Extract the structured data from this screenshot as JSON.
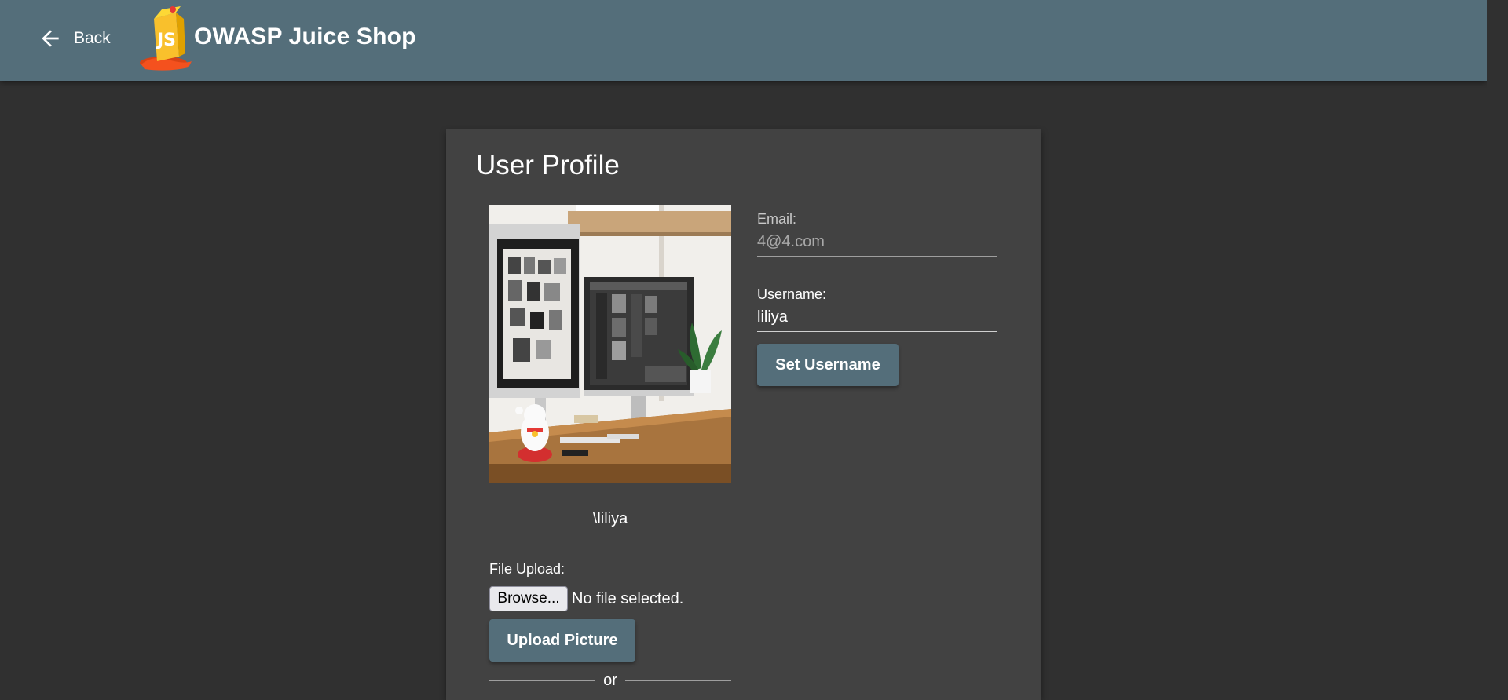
{
  "toolbar": {
    "back_label": "Back",
    "app_title": "OWASP Juice Shop",
    "logo_text": "JS",
    "background_color": "#546e7a"
  },
  "profile": {
    "title": "User Profile",
    "display_name": "\\liliya",
    "email_label": "Email:",
    "email_value": "4@4.com",
    "username_label": "Username:",
    "username_value": "liliya",
    "set_username_label": "Set Username",
    "file_upload_label": "File Upload:",
    "browse_label": "Browse...",
    "file_status": "No file selected.",
    "upload_picture_label": "Upload Picture",
    "or_label": "or"
  },
  "colors": {
    "page_background": "#303030",
    "card_background": "#424242",
    "accent": "#546e7a"
  }
}
